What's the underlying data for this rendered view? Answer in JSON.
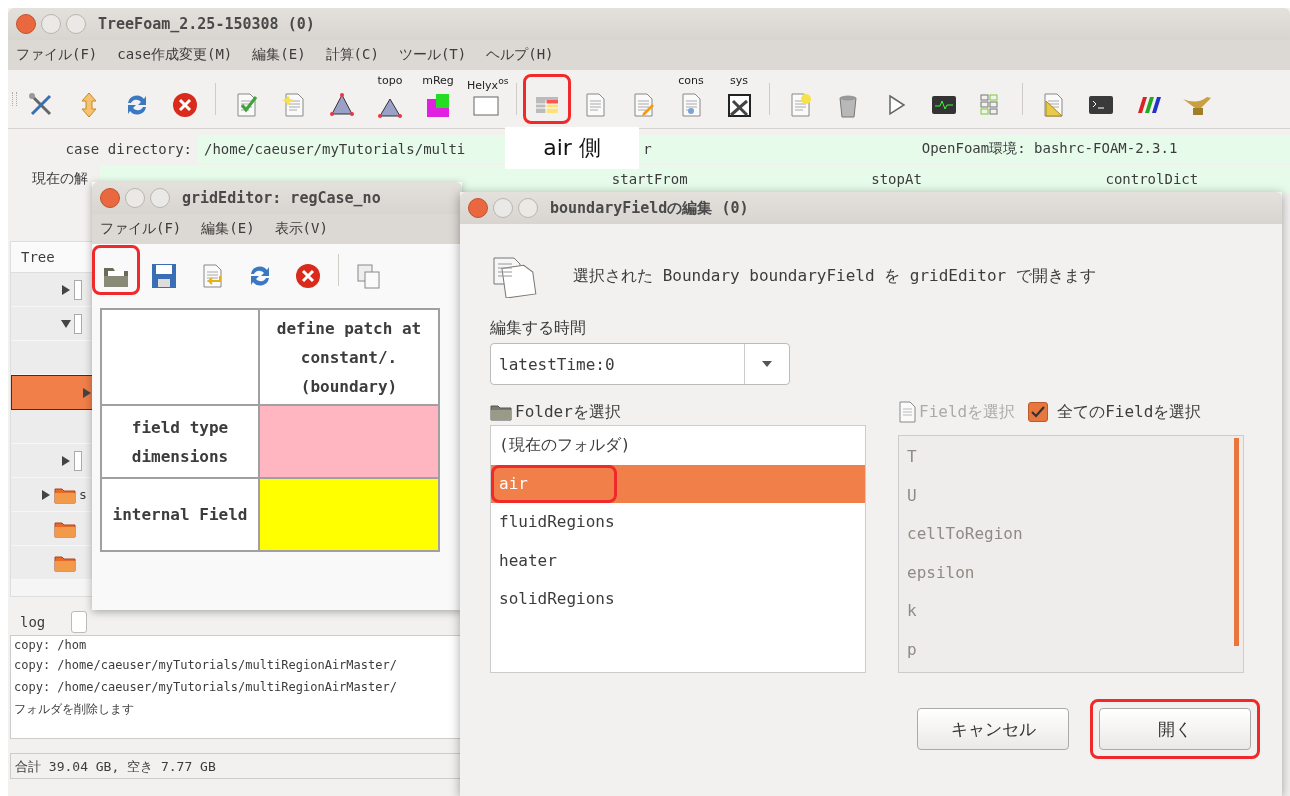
{
  "main_window": {
    "title": "TreeFoam_2.25-150308 (0)",
    "menu": [
      "ファイル(F)",
      "case作成変更(M)",
      "編集(E)",
      "計算(C)",
      "ツール(T)",
      "ヘルプ(H)"
    ],
    "toolbar": [
      {
        "kind": "button",
        "highlight": false
      },
      {
        "kind": "button",
        "highlight": false
      },
      {
        "kind": "button",
        "highlight": false
      },
      {
        "kind": "button",
        "highlight": false
      },
      {
        "kind": "separator"
      },
      {
        "kind": "button",
        "highlight": false
      },
      {
        "kind": "button",
        "highlight": false
      },
      {
        "kind": "button",
        "highlight": false
      },
      {
        "kind": "button",
        "label": "topo",
        "highlight": false
      },
      {
        "kind": "button",
        "label": "mReg",
        "highlight": false
      },
      {
        "kind": "button",
        "label": "Helyx$^{os}$",
        "highlight": false
      },
      {
        "kind": "separator"
      },
      {
        "kind": "button",
        "highlight": true
      },
      {
        "kind": "button",
        "highlight": false
      },
      {
        "kind": "button",
        "highlight": false
      },
      {
        "kind": "button",
        "label": "cons",
        "highlight": false
      },
      {
        "kind": "button",
        "label": "sys",
        "highlight": false
      },
      {
        "kind": "separator"
      },
      {
        "kind": "button",
        "highlight": false
      },
      {
        "kind": "button",
        "highlight": false
      },
      {
        "kind": "button",
        "highlight": false
      },
      {
        "kind": "button",
        "highlight": false
      },
      {
        "kind": "button",
        "highlight": false
      },
      {
        "kind": "separator"
      },
      {
        "kind": "button",
        "highlight": false
      },
      {
        "kind": "button",
        "highlight": false
      },
      {
        "kind": "button",
        "highlight": false
      },
      {
        "kind": "button",
        "highlight": false
      }
    ],
    "case_directory_label": "case directory:",
    "case_directory": "/home/caeuser/myTutorials/multi",
    "case_directory_tail": "r",
    "environment": "OpenFoam環境: bashrc-FOAM-2.3.1",
    "current_case_label": "現在の解",
    "columns": [
      "startFrom",
      "stopAt",
      "controlDict"
    ],
    "tree": {
      "header": "Tree",
      "items": [
        {
          "kind": "offscreen",
          "children": [
            {
              "kind": "checkbox",
              "expanded": false,
              "selected": false
            },
            {
              "kind": "checkbox",
              "expanded": true,
              "selected": false,
              "children": [
                {
                  "kind": "checkbox",
                  "selected": false
                },
                {
                  "kind": "checkbox",
                  "expanded": false,
                  "selected": true
                },
                {
                  "kind": "checkbox",
                  "selected": false
                }
              ]
            },
            {
              "kind": "checkbox",
              "expanded": false,
              "selected": false
            }
          ]
        },
        {
          "kind": "folder",
          "expanded": false,
          "selected": false,
          "label": "s"
        },
        {
          "kind": "folder",
          "selected": false
        },
        {
          "kind": "folder",
          "selected": false
        }
      ]
    },
    "log_label": "log",
    "log": [
      "copy: /hom",
      "copy: /home/caeuser/myTutorials/multiRegionAirMaster/",
      "copy: /home/caeuser/myTutorials/multiRegionAirMaster/",
      "フォルダを削除します"
    ],
    "status_bar": "合計 39.04 GB,  空き 7.77 GB"
  },
  "grid_editor": {
    "title": "gridEditor: regCase_no",
    "menu": [
      "ファイル(F)",
      "編集(E)",
      "表示(V)"
    ],
    "toolbar": [
      {
        "highlight": true
      },
      {
        "highlight": false
      },
      {
        "highlight": false
      },
      {
        "highlight": false
      },
      {
        "highlight": false
      },
      {
        "highlight": false
      }
    ],
    "table": {
      "header": "define patch at constant/. (boundary)",
      "rows": [
        {
          "label": "field type dimensions",
          "color": "#ffb6c1"
        },
        {
          "label": "internal Field",
          "color": "#ffff00"
        }
      ]
    }
  },
  "dialog": {
    "title": "boundaryFieldの編集 (0)",
    "message": "選択された Boundary boundaryField を gridEditor で開きます",
    "time_label": "編集する時間",
    "time_value": "latestTime:0",
    "folder_label": "Folderを選択",
    "folders": [
      {
        "label": "(現在のフォルダ)",
        "selected": false,
        "highlight": false
      },
      {
        "label": "air",
        "selected": true,
        "highlight": true
      },
      {
        "label": "fluidRegions",
        "selected": false,
        "highlight": false
      },
      {
        "label": "heater",
        "selected": false,
        "highlight": false
      },
      {
        "label": "solidRegions",
        "selected": false,
        "highlight": false
      }
    ],
    "field_label": "Fieldを選択",
    "select_all": {
      "label": "全てのFieldを選択",
      "checked": true
    },
    "fields": [
      "T",
      "U",
      "cellToRegion",
      "epsilon",
      "k",
      "p"
    ],
    "fields_disabled": true,
    "buttons": [
      {
        "label": "キャンセル",
        "highlight": false
      },
      {
        "label": "開く",
        "highlight": true
      }
    ]
  },
  "annotation": "air 側"
}
